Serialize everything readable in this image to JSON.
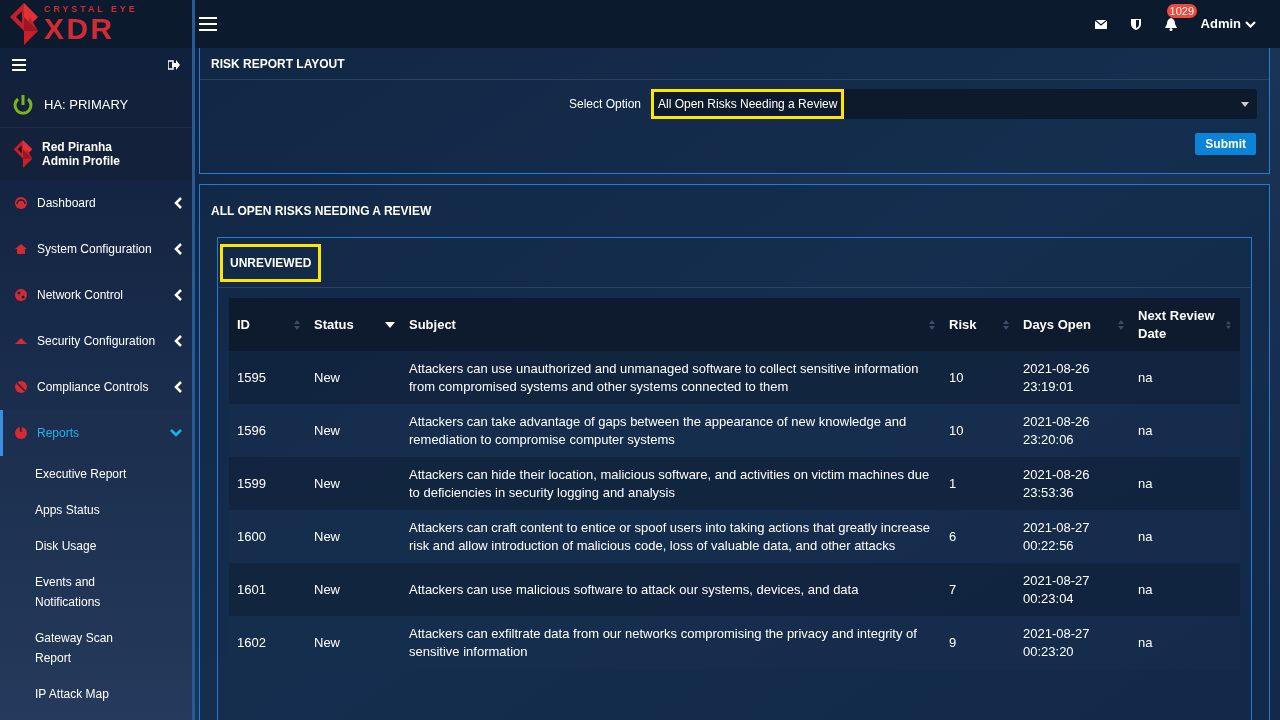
{
  "brand": {
    "line1": "CRYSTAL EYE",
    "line2": "XDR"
  },
  "topbar": {
    "notification_count": "1029",
    "user": "Admin"
  },
  "sidebar": {
    "ha_status": "HA: PRIMARY",
    "profile": {
      "name": "Red Piranha",
      "role": "Admin Profile"
    },
    "items": [
      {
        "label": "Dashboard",
        "selected": false,
        "expanded": false
      },
      {
        "label": "System Configuration",
        "selected": false,
        "expanded": false
      },
      {
        "label": "Network Control",
        "selected": false,
        "expanded": false
      },
      {
        "label": "Security Configuration",
        "selected": false,
        "expanded": false
      },
      {
        "label": "Compliance Controls",
        "selected": false,
        "expanded": false
      },
      {
        "label": "Reports",
        "selected": true,
        "expanded": true,
        "children": [
          {
            "label": "Executive Report"
          },
          {
            "label": "Apps Status"
          },
          {
            "label": "Disk Usage"
          },
          {
            "label": "Events and Notifications"
          },
          {
            "label": "Gateway Scan Report"
          },
          {
            "label": "IP Attack Map"
          }
        ]
      }
    ]
  },
  "layout_panel": {
    "title": "RISK REPORT LAYOUT",
    "select_label": "Select Option",
    "select_value": "All Open Risks Needing a Review",
    "select_highlighted": true,
    "submit": "Submit"
  },
  "risks_panel": {
    "title": "ALL OPEN RISKS NEEDING A REVIEW",
    "section": "UNREVIEWED",
    "section_highlighted": true,
    "columns": [
      {
        "label": "ID",
        "sorted": false
      },
      {
        "label": "Status",
        "sorted": true
      },
      {
        "label": "Subject",
        "sorted": false
      },
      {
        "label": "Risk",
        "sorted": false
      },
      {
        "label": "Days Open",
        "sorted": false
      },
      {
        "label": "Next Review Date",
        "sorted": false
      }
    ],
    "rows": [
      [
        "1595",
        "New",
        "Attackers can use unauthorized and unmanaged software to collect sensitive information from compromised systems and other systems connected to them",
        "10",
        "2021-08-26 23:19:01",
        "na"
      ],
      [
        "1596",
        "New",
        "Attackers can take advantage of gaps between the appearance of new knowledge and remediation to compromise computer systems",
        "10",
        "2021-08-26 23:20:06",
        "na"
      ],
      [
        "1599",
        "New",
        "Attackers can hide their location, malicious software, and activities on victim machines due to deficiencies in security logging and analysis",
        "1",
        "2021-08-26 23:53:36",
        "na"
      ],
      [
        "1600",
        "New",
        "Attackers can craft content to entice or spoof users into taking actions that greatly increase risk and allow introduction of malicious code, loss of valuable data, and other attacks",
        "6",
        "2021-08-27 00:22:56",
        "na"
      ],
      [
        "1601",
        "New",
        "Attackers can use malicious software to attack our systems, devices, and data",
        "7",
        "2021-08-27 00:23:04",
        "na"
      ],
      [
        "1602",
        "New",
        "Attackers can exfiltrate data from our networks compromising the privacy and integrity of sensitive information",
        "9",
        "2021-08-27 00:23:20",
        "na"
      ]
    ]
  }
}
